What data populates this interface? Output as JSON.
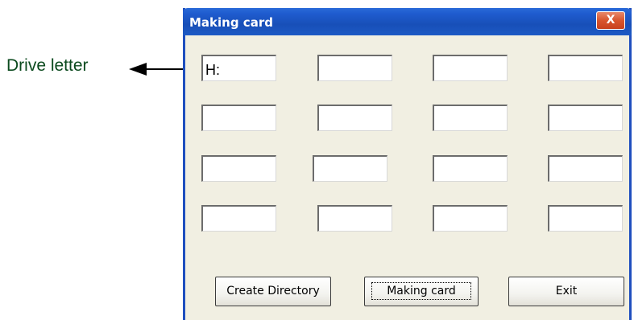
{
  "annotation": {
    "label": "Drive letter"
  },
  "window": {
    "title": "Making card",
    "close_glyph": "X"
  },
  "drive_fields": [
    {
      "value": "H:"
    },
    {
      "value": ""
    },
    {
      "value": ""
    },
    {
      "value": ""
    },
    {
      "value": ""
    },
    {
      "value": ""
    },
    {
      "value": ""
    },
    {
      "value": ""
    },
    {
      "value": ""
    },
    {
      "value": ""
    },
    {
      "value": ""
    },
    {
      "value": ""
    },
    {
      "value": ""
    },
    {
      "value": ""
    },
    {
      "value": ""
    },
    {
      "value": ""
    }
  ],
  "buttons": {
    "create_directory": "Create Directory",
    "making_card": "Making card",
    "exit": "Exit"
  },
  "colors": {
    "titlebar": "#1f5ccf",
    "close_button": "#d8552e",
    "window_bg": "#f1efe2",
    "annotation_text": "#0b4a1e"
  },
  "icons": {
    "annotation_pointer": "arrow-left-icon",
    "close": "close-icon"
  }
}
